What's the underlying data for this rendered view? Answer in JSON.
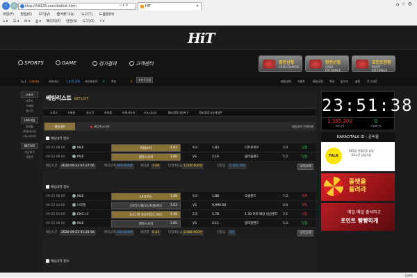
{
  "browser": {
    "url": "http://hit135.com/betlist.html",
    "tab_title": "HIT",
    "menu": [
      "파일(F)",
      "편집(E)",
      "보기(V)",
      "즐겨찾기(A)",
      "도구(T)",
      "도움말(H)"
    ],
    "commands": [
      "페이지(P)",
      "안전(S)",
      "도구(O)"
    ],
    "zoom": "100%"
  },
  "site": {
    "logo": "HiT",
    "nav": {
      "sports": "SPORTS",
      "game": "GAME",
      "results": "경기결과",
      "support": "고객센터"
    },
    "cta": [
      {
        "title": "충전신청",
        "sub": "CASH CHARGE"
      },
      {
        "title": "환전신청",
        "sub": "CASH EXCHANGE"
      },
      {
        "title": "포인트전환",
        "sub": "POINT EXCHANGE"
      }
    ],
    "info": {
      "level": "Lv.1",
      "user": "오래하자",
      "money_label": "보유머니",
      "money": "1,355,200",
      "point_label": "보유포인트",
      "point": "0",
      "msg_label": "쪽지",
      "msg": "0",
      "point_btn": "포인트전환",
      "links": [
        "베팅내역",
        "이벤트",
        "베팅규정",
        "쪽지",
        "출석부",
        "충전",
        "로그아웃"
      ]
    }
  },
  "sidebar": {
    "groups": [
      {
        "head": "스포츠",
        "items": [
          "크로스",
          "스페셜",
          "실시간"
        ]
      },
      {
        "head": "LIVE게임",
        "items": [
          "파워볼",
          "파워사다리",
          "키노사다리"
        ]
      },
      {
        "head": "BET365",
        "items": [
          "가상축구",
          "개경주"
        ]
      }
    ]
  },
  "main": {
    "title": "베팅리스트",
    "subtitle": "BETLIST",
    "tabs": [
      "크로스",
      "스페셜",
      "실시간",
      "파워볼",
      "파워사다리",
      "키노사다리",
      "Bet365가상축구",
      "Bet365가상개경주"
    ],
    "filter_active": "배팅내역",
    "filter_mid": "배팅취소내역",
    "filter_right": "배팅내역 전체삭제",
    "bets": [
      {
        "head": "베팅내역 정보",
        "rows": [
          {
            "time": "09-22 08:00",
            "league": "MLB",
            "home": "미네소타",
            "odd1": "1.91",
            "mid": "9.0",
            "odd2": "1.83",
            "away": "디트로이트",
            "score": "3:3",
            "result": "당첨",
            "sel": true
          },
          {
            "time": "09-22 08:00",
            "league": "MLB",
            "home": "캔자스시티",
            "odd1": "1.60",
            "mid": "VS",
            "odd2": "2.16",
            "away": "클리블랜드",
            "score": "5:2",
            "result": "당첨",
            "sel": true
          }
        ],
        "summary": {
          "time_label": "배팅시간",
          "time": "2020-09-22 07:27:56",
          "amount_label": "배팅금액",
          "amount": "490,000원",
          "odds_label": "배당률",
          "odds": "3.08",
          "expected_label": "당첨예상금",
          "expected": "1,509,600원",
          "win_label": "당첨금",
          "win": "1,355,200",
          "del": "내역삭제"
        }
      },
      {
        "head": "베팅내역 정보",
        "rows": [
          {
            "time": "09-22 08:00",
            "league": "MLB",
            "home": "LA다저스",
            "odd1": "1.88",
            "mid": "9.0",
            "odd2": "1.88",
            "away": "오클랜드",
            "score": "7:2",
            "result": "적특",
            "sel": true
          },
          {
            "time": "09-22 04:00",
            "league": "브라질",
            "home": "[브라스예(오)/포겔(베)]",
            "odd1": "1.03",
            "mid": "VS",
            "odd2": "9,999.00",
            "away": "",
            "score": "0:0",
            "result": "적특",
            "sel": false
          },
          {
            "time": "09-22 04:00",
            "league": "ENG LC",
            "home": "[LC] 맨 유나이티드 AFC",
            "odd1": "1.98",
            "mid": "2.5",
            "odd2": "1.78",
            "away": "1.30 이하 배당 잉글랜드",
            "score": "3:1",
            "result": "낙첨",
            "sel": true
          },
          {
            "time": "09-22 08:00",
            "league": "MLB",
            "home": "캔자스시티",
            "odd1": "1.65",
            "mid": "VS",
            "odd2": "2.11",
            "away": "클리블랜드",
            "score": "5:2",
            "result": "당첨",
            "sel": false
          }
        ],
        "summary": {
          "time_label": "배팅시간",
          "time": "2020-09-23 01:25:56",
          "amount_label": "배팅금액",
          "amount": "330,000원",
          "odds_label": "배당률",
          "odds": "6.33",
          "expected_label": "당첨예상금",
          "expected": "2,088,900원",
          "win_label": "당첨금",
          "win": "0원",
          "del": "내역삭제"
        }
      },
      {
        "head": "베팅내역 정보"
      }
    ]
  },
  "right": {
    "clock": "23:51:38",
    "money": "1,355,200",
    "money_label": "보유금액",
    "point": "0",
    "point_label": "보유포인트",
    "kakao_title": "KAKAOTALK ID : 준비중",
    "kakao_bubble": "TALK",
    "kakao_line1": "365일 연중무휴 상담",
    "kakao_line2": "24시간 상담가능",
    "banner1_line1": "돌렛을",
    "banner1_line2": "돌려라",
    "banner2_line1": "매일 매일 출석하고",
    "banner2_line2": "포인트 빵빵하게"
  },
  "colors": {
    "accent": "#8c7440",
    "win": "#2fd65a",
    "lose": "#ff4040",
    "blue": "#4aa3ff"
  }
}
